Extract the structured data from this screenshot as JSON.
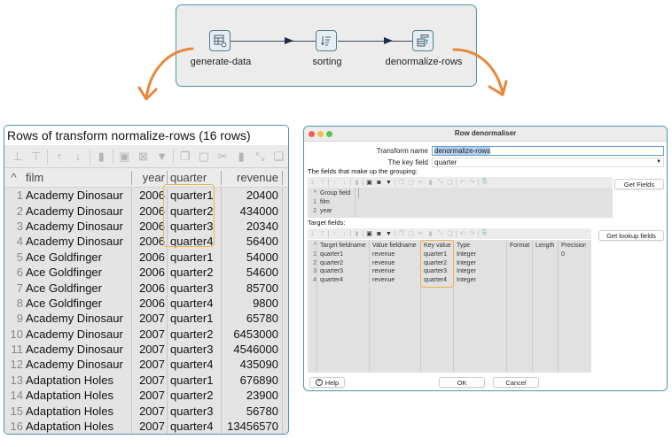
{
  "pipeline": {
    "nodes": [
      {
        "label": "generate-data",
        "icon": "table-gear-icon"
      },
      {
        "label": "sorting",
        "icon": "sort-icon"
      },
      {
        "label": "denormalize-rows",
        "icon": "denormalize-icon"
      }
    ]
  },
  "preview": {
    "title": "Rows of transform normalize-rows (16 rows)",
    "columns": {
      "sort": "^",
      "film": "film",
      "year": "year",
      "quarter": "quarter",
      "revenue": "revenue"
    },
    "rows": [
      {
        "idx": "1",
        "film": "Academy Dinosaur",
        "year": "2006",
        "quarter": "quarter1",
        "revenue": "20400"
      },
      {
        "idx": "2",
        "film": "Academy Dinosaur",
        "year": "2006",
        "quarter": "quarter2",
        "revenue": "434000"
      },
      {
        "idx": "3",
        "film": "Academy Dinosaur",
        "year": "2006",
        "quarter": "quarter3",
        "revenue": "20340"
      },
      {
        "idx": "4",
        "film": "Academy Dinosaur",
        "year": "2006",
        "quarter": "quarter4",
        "revenue": "56400"
      },
      {
        "idx": "5",
        "film": "Ace Goldfinger",
        "year": "2006",
        "quarter": "quarter1",
        "revenue": "54000"
      },
      {
        "idx": "6",
        "film": "Ace Goldfinger",
        "year": "2006",
        "quarter": "quarter2",
        "revenue": "54600"
      },
      {
        "idx": "7",
        "film": "Ace Goldfinger",
        "year": "2006",
        "quarter": "quarter3",
        "revenue": "85700"
      },
      {
        "idx": "8",
        "film": "Ace Goldfinger",
        "year": "2006",
        "quarter": "quarter4",
        "revenue": "9800"
      },
      {
        "idx": "9",
        "film": "Academy Dinosaur",
        "year": "2007",
        "quarter": "quarter1",
        "revenue": "65780"
      },
      {
        "idx": "10",
        "film": "Academy Dinosaur",
        "year": "2007",
        "quarter": "quarter2",
        "revenue": "6453000"
      },
      {
        "idx": "11",
        "film": "Academy Dinosaur",
        "year": "2007",
        "quarter": "quarter3",
        "revenue": "4546000"
      },
      {
        "idx": "12",
        "film": "Academy Dinosaur",
        "year": "2007",
        "quarter": "quarter4",
        "revenue": "435090"
      },
      {
        "idx": "13",
        "film": "Adaptation Holes",
        "year": "2007",
        "quarter": "quarter1",
        "revenue": "676890"
      },
      {
        "idx": "14",
        "film": "Adaptation Holes",
        "year": "2007",
        "quarter": "quarter2",
        "revenue": "23900"
      },
      {
        "idx": "15",
        "film": "Adaptation Holes",
        "year": "2007",
        "quarter": "quarter3",
        "revenue": "56780"
      },
      {
        "idx": "16",
        "film": "Adaptation Holes",
        "year": "2007",
        "quarter": "quarter4",
        "revenue": "13456570"
      }
    ]
  },
  "dialog": {
    "title": "Row denormaliser",
    "transform_name_label": "Transform name",
    "transform_name_value": "denormalize-rows",
    "key_field_label": "The key field",
    "key_field_value": "quarter",
    "grouping_label": "The fields that make up the grouping:",
    "group_header": "Group field",
    "group_rows": [
      {
        "idx": "1",
        "field": "film"
      },
      {
        "idx": "2",
        "field": "year"
      }
    ],
    "get_fields_button": "Get Fields",
    "target_label": "Target fields:",
    "get_lookup_button": "Get lookup fields",
    "target_columns": [
      "Target fieldname",
      "Value fieldname",
      "Key value",
      "Type",
      "Format",
      "Length",
      "Precision"
    ],
    "target_rows": [
      {
        "idx": "1",
        "target": "quarter1",
        "value": "revenue",
        "key": "quarter1",
        "type": "Integer",
        "format": "",
        "length": "",
        "precision": "0"
      },
      {
        "idx": "2",
        "target": "quarter2",
        "value": "revenue",
        "key": "quarter2",
        "type": "Integer",
        "format": "",
        "length": "",
        "precision": ""
      },
      {
        "idx": "3",
        "target": "quarter3",
        "value": "revenue",
        "key": "quarter3",
        "type": "Integer",
        "format": "",
        "length": "",
        "precision": ""
      },
      {
        "idx": "4",
        "target": "quarter4",
        "value": "revenue",
        "key": "quarter4",
        "type": "Integer",
        "format": "",
        "length": "",
        "precision": ""
      }
    ],
    "help_button": "Help",
    "ok_button": "OK",
    "cancel_button": "Cancel"
  },
  "colors": {
    "accent_border": "#4a95b0",
    "highlight": "#f0b24c",
    "curve_arrow": "#e8873a"
  }
}
